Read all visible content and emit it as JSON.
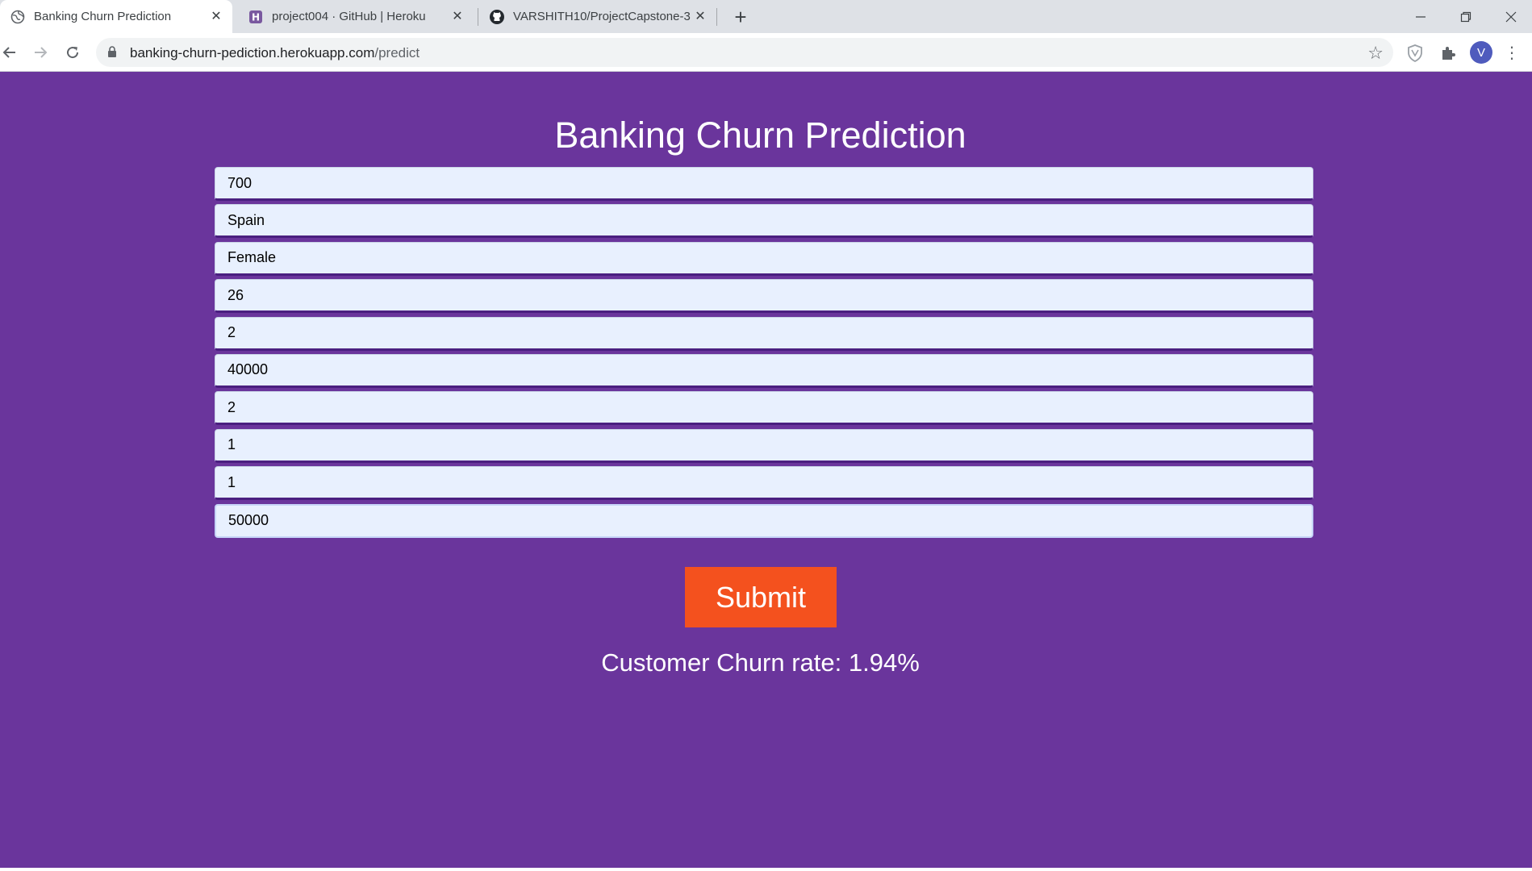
{
  "browser": {
    "tabs": [
      {
        "title": "Banking Churn Prediction",
        "icon": "globe-icon",
        "active": true
      },
      {
        "title": "project004 · GitHub | Heroku",
        "icon": "heroku-icon",
        "active": false
      },
      {
        "title": "VARSHITH10/ProjectCapstone-3",
        "icon": "github-icon",
        "active": false
      }
    ],
    "new_tab_label": "+",
    "url_host": "banking-churn-pediction.herokuapp.com",
    "url_path": "/predict",
    "profile_initial": "V"
  },
  "page": {
    "title": "Banking Churn Prediction",
    "fields": [
      {
        "value": "700"
      },
      {
        "value": "Spain"
      },
      {
        "value": "Female"
      },
      {
        "value": "26"
      },
      {
        "value": "2"
      },
      {
        "value": "40000"
      },
      {
        "value": "2"
      },
      {
        "value": "1"
      },
      {
        "value": "1"
      },
      {
        "value": "50000"
      }
    ],
    "submit_label": "Submit",
    "result_text": "Customer Churn rate: 1.94%"
  },
  "colors": {
    "background": "#6a359c",
    "submit": "#f4511e",
    "field": "#e8f0fe"
  }
}
